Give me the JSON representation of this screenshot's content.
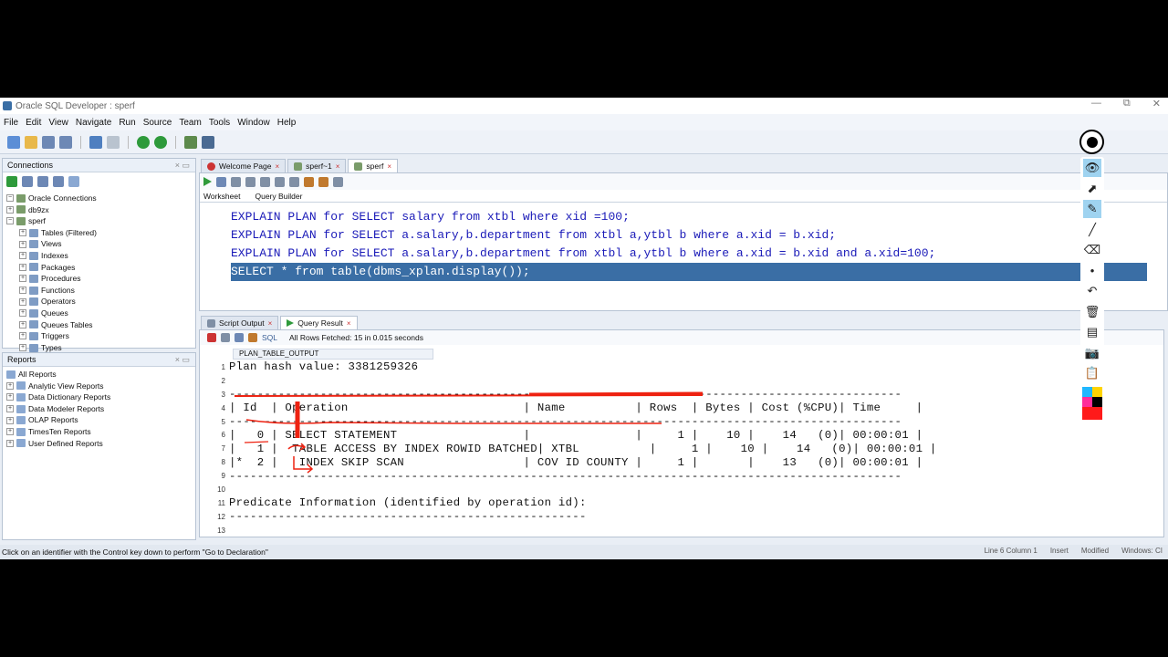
{
  "window": {
    "title": "Oracle SQL Developer : sperf"
  },
  "menu": [
    "File",
    "Edit",
    "View",
    "Navigate",
    "Run",
    "Source",
    "Team",
    "Tools",
    "Window",
    "Help"
  ],
  "connections": {
    "header": "Connections",
    "items": [
      {
        "label": "Oracle Connections",
        "level": 0
      },
      {
        "label": "db9zx",
        "level": 0
      },
      {
        "label": "sperf",
        "level": 0
      },
      {
        "label": "Tables (Filtered)",
        "level": 1
      },
      {
        "label": "Views",
        "level": 1
      },
      {
        "label": "Indexes",
        "level": 1
      },
      {
        "label": "Packages",
        "level": 1
      },
      {
        "label": "Procedures",
        "level": 1
      },
      {
        "label": "Functions",
        "level": 1
      },
      {
        "label": "Operators",
        "level": 1
      },
      {
        "label": "Queues",
        "level": 1
      },
      {
        "label": "Queues Tables",
        "level": 1
      },
      {
        "label": "Triggers",
        "level": 1
      },
      {
        "label": "Types",
        "level": 1
      }
    ]
  },
  "reports": {
    "header": "Reports",
    "items": [
      "All Reports",
      "Analytic View Reports",
      "Data Dictionary Reports",
      "Data Modeler Reports",
      "OLAP Reports",
      "TimesTen Reports",
      "User Defined Reports"
    ]
  },
  "editor": {
    "tabs": [
      "Welcome Page",
      "sperf~1",
      "sperf"
    ],
    "subtabs": [
      "Worksheet",
      "Query Builder"
    ],
    "connection_select": "sperf",
    "lines": [
      "EXPLAIN PLAN for SELECT salary from xtbl where xid =100;",
      "EXPLAIN PLAN for SELECT a.salary,b.department from xtbl a,ytbl b where a.xid = b.xid;",
      "EXPLAIN PLAN for SELECT a.salary,b.department from xtbl a,ytbl b where a.xid = b.xid and a.xid=100;",
      "SELECT * from table(dbms_xplan.display());"
    ]
  },
  "results": {
    "tabs": [
      "Script Output",
      "Query Result"
    ],
    "sql_label": "SQL",
    "fetch_status": "All Rows Fetched: 15 in 0.015 seconds",
    "column": "PLAN_TABLE_OUTPUT",
    "rows": [
      {
        "n": "1",
        "text": "Plan hash value: 3381259326"
      },
      {
        "n": "2",
        "text": ""
      },
      {
        "n": "3",
        "text": "------------------------------------------------------------------------------------------------"
      },
      {
        "n": "4",
        "text": "| Id  | Operation                         | Name          | Rows  | Bytes | Cost (%CPU)| Time     |"
      },
      {
        "n": "5",
        "text": "------------------------------------------------------------------------------------------------"
      },
      {
        "n": "6",
        "text": "|   0 | SELECT STATEMENT                  |               |     1 |    10 |    14   (0)| 00:00:01 |"
      },
      {
        "n": "7",
        "text": "|   1 |  TABLE ACCESS BY INDEX ROWID BATCHED| XTBL          |     1 |    10 |    14   (0)| 00:00:01 |"
      },
      {
        "n": "8",
        "text": "|*  2 |   INDEX SKIP SCAN                 | COV ID COUNTY |     1 |       |    13   (0)| 00:00:01 |"
      },
      {
        "n": "9",
        "text": "------------------------------------------------------------------------------------------------"
      },
      {
        "n": "10",
        "text": ""
      },
      {
        "n": "11",
        "text": "Predicate Information (identified by operation id):"
      },
      {
        "n": "12",
        "text": "---------------------------------------------------"
      },
      {
        "n": "13",
        "text": ""
      }
    ]
  },
  "status": {
    "message": "Click on an identifier with the Control key down to perform \"Go to Declaration\"",
    "position": "Line 6 Column 1",
    "mode": "Insert",
    "modified": "Modified",
    "platform": "Windows: CI"
  }
}
